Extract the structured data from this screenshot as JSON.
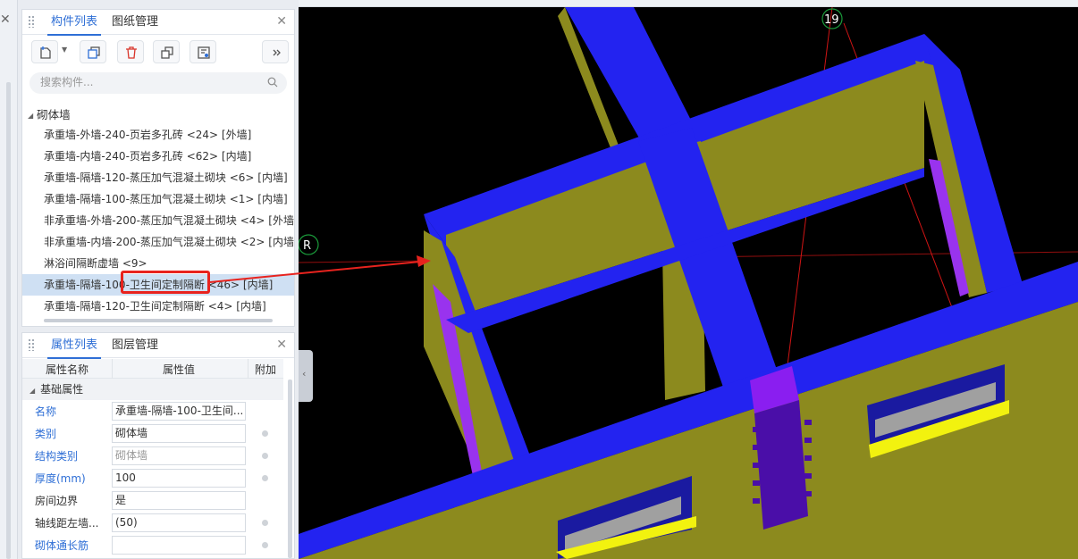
{
  "component_panel": {
    "tabs": [
      "构件列表",
      "图纸管理"
    ],
    "search_placeholder": "搜索构件...",
    "category": "砌体墙",
    "items": [
      "承重墙-外墙-240-页岩多孔砖 <24> [外墙]",
      "承重墙-内墙-240-页岩多孔砖 <62> [内墙]",
      "承重墙-隔墙-120-蒸压加气混凝土砌块 <6> [内墙]",
      "承重墙-隔墙-100-蒸压加气混凝土砌块 <1> [内墙]",
      "非承重墙-外墙-200-蒸压加气混凝土砌块 <4> [外墙",
      "非承重墙-内墙-200-蒸压加气混凝土砌块 <2> [内墙",
      "淋浴间隔断虚墙 <9>",
      "承重墙-隔墙-100-卫生间定制隔断 <46> [内墙]",
      "承重墙-隔墙-120-卫生间定制隔断 <4> [内墙]"
    ],
    "selected_index": 7
  },
  "property_panel": {
    "tabs": [
      "属性列表",
      "图层管理"
    ],
    "columns": [
      "属性名称",
      "属性值",
      "附加"
    ],
    "group": "基础属性",
    "rows": [
      {
        "name": "名称",
        "value": "承重墙-隔墙-100-卫生间..."
      },
      {
        "name": "类别",
        "value": "砌体墙"
      },
      {
        "name": "结构类别",
        "value": "砌体墙"
      },
      {
        "name": "厚度(mm)",
        "value": "100"
      },
      {
        "name": "房间边界",
        "value": "是"
      },
      {
        "name": "轴线距左墙...",
        "value": "(50)"
      },
      {
        "name": "砌体通长筋",
        "value": ""
      }
    ]
  },
  "viewport": {
    "axis_labels": [
      "19",
      "R"
    ]
  },
  "colors": {
    "accent": "#2f6fd6",
    "wall_top": "#2323f0",
    "wall_face": "#8c8a1e",
    "highlight": "#e8231e"
  }
}
